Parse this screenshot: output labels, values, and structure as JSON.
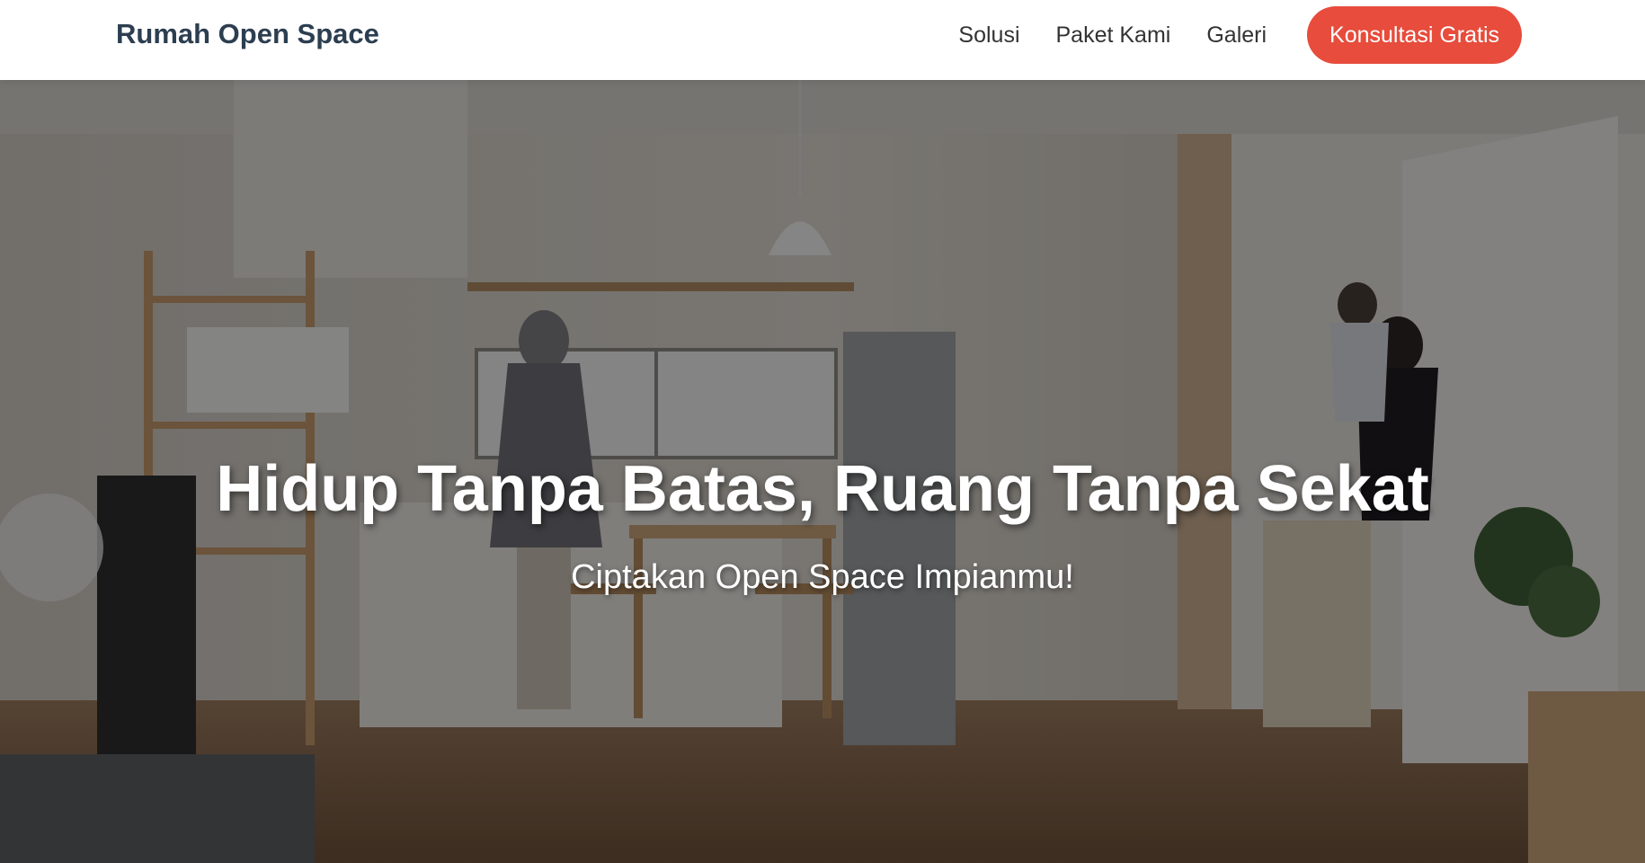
{
  "navbar": {
    "brand": "Rumah Open Space",
    "links": [
      {
        "label": "Solusi"
      },
      {
        "label": "Paket Kami"
      },
      {
        "label": "Galeri"
      }
    ],
    "cta_label": "Konsultasi Gratis"
  },
  "hero": {
    "title": "Hidup Tanpa Batas, Ruang Tanpa Sekat",
    "subtitle": "Ciptakan Open Space Impianmu!"
  },
  "colors": {
    "brand_text": "#2c3e50",
    "cta_background": "#e74c3c",
    "nav_text": "#333333",
    "hero_text": "#ffffff"
  }
}
